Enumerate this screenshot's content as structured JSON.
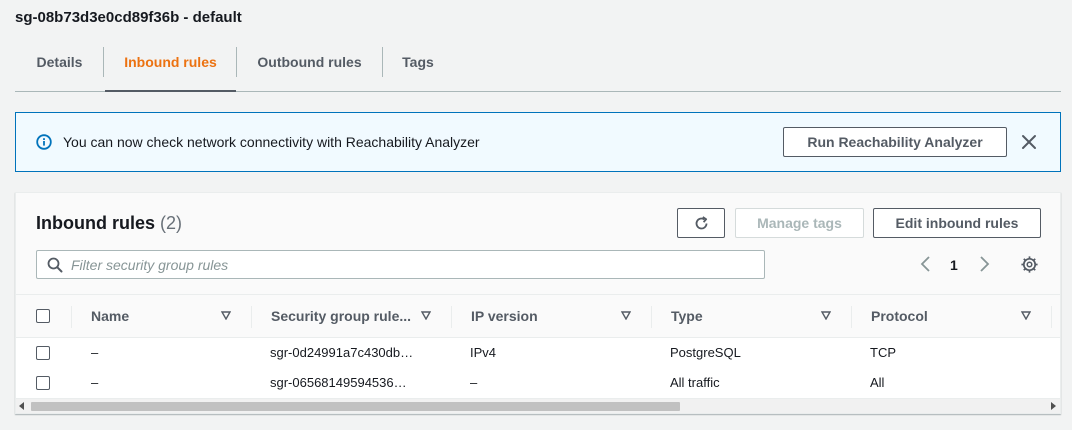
{
  "page": {
    "title": "sg-08b73d3e0cd89f36b - default"
  },
  "tabs": [
    {
      "label": "Details",
      "active": false
    },
    {
      "label": "Inbound rules",
      "active": true
    },
    {
      "label": "Outbound rules",
      "active": false
    },
    {
      "label": "Tags",
      "active": false
    }
  ],
  "flash": {
    "icon": "info-icon",
    "message": "You can now check network connectivity with Reachability Analyzer",
    "button_label": "Run Reachability Analyzer",
    "close_icon": "close-icon"
  },
  "panel": {
    "title": "Inbound rules",
    "count": "(2)",
    "refresh_icon": "refresh-icon",
    "manage_tags_label": "Manage tags",
    "edit_label": "Edit inbound rules",
    "search_placeholder": "Filter security group rules",
    "search_value": "",
    "page_number": "1"
  },
  "table": {
    "columns": [
      "Name",
      "Security group rule...",
      "IP version",
      "Type",
      "Protocol"
    ],
    "rows": [
      {
        "name": "–",
        "rule_id": "sgr-0d24991a7c430db…",
        "ip_version": "IPv4",
        "type": "PostgreSQL",
        "protocol": "TCP"
      },
      {
        "name": "–",
        "rule_id": "sgr-06568149594536…",
        "ip_version": "–",
        "type": "All traffic",
        "protocol": "All"
      }
    ]
  },
  "colors": {
    "accent": "#ec7211",
    "info_blue": "#0073bb",
    "flash_bg": "#f1faff",
    "text": "#16191f",
    "muted": "#545b64"
  }
}
